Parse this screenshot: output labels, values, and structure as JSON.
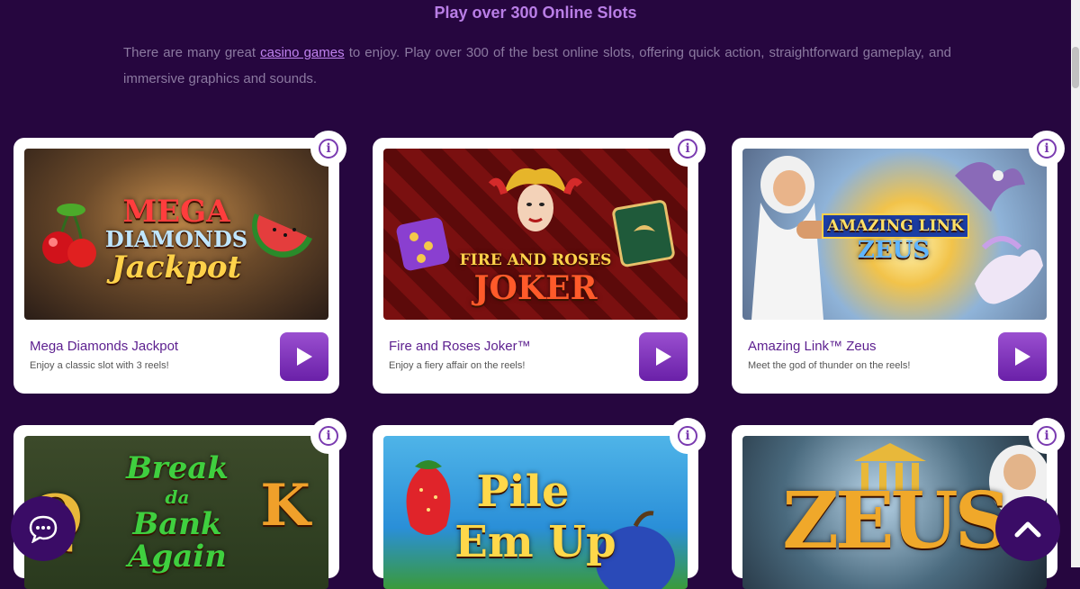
{
  "section": {
    "heading": "Play over 300 Online Slots",
    "intro_before": "There are many great ",
    "intro_link": "casino games",
    "intro_after": " to enjoy. Play over 300 of the best online slots, offering quick action, straightforward gameplay, and immersive graphics and sounds."
  },
  "games": [
    {
      "title": "Mega Diamonds Jackpot",
      "desc": "Enjoy a classic slot with 3 reels!",
      "logo_1": "MEGA",
      "logo_2": "DIAMONDS",
      "logo_3": "Jackpot"
    },
    {
      "title": "Fire and Roses Joker™",
      "desc": "Enjoy a fiery affair on the reels!",
      "logo_1": "FIRE AND ROSES",
      "logo_2": "JOKER"
    },
    {
      "title": "Amazing Link™ Zeus",
      "desc": "Meet the god of thunder on the reels!",
      "logo_1": "AMAZING LINK",
      "logo_2": "ZEUS"
    },
    {
      "logo_1": "Break",
      "logo_2": "da",
      "logo_3": "Bank",
      "logo_4": "Again",
      "logo_5": "K"
    },
    {
      "logo_1": "Pile",
      "logo_2": "Em Up"
    },
    {
      "logo_1": "ZEUS"
    }
  ],
  "icons": {
    "info": "info-icon",
    "play": "play-icon",
    "chat": "chat-icon",
    "scroll_top": "chevron-up-icon"
  },
  "colors": {
    "background": "#26063f",
    "accent": "#7a3bb0",
    "heading": "#b97ee6"
  }
}
